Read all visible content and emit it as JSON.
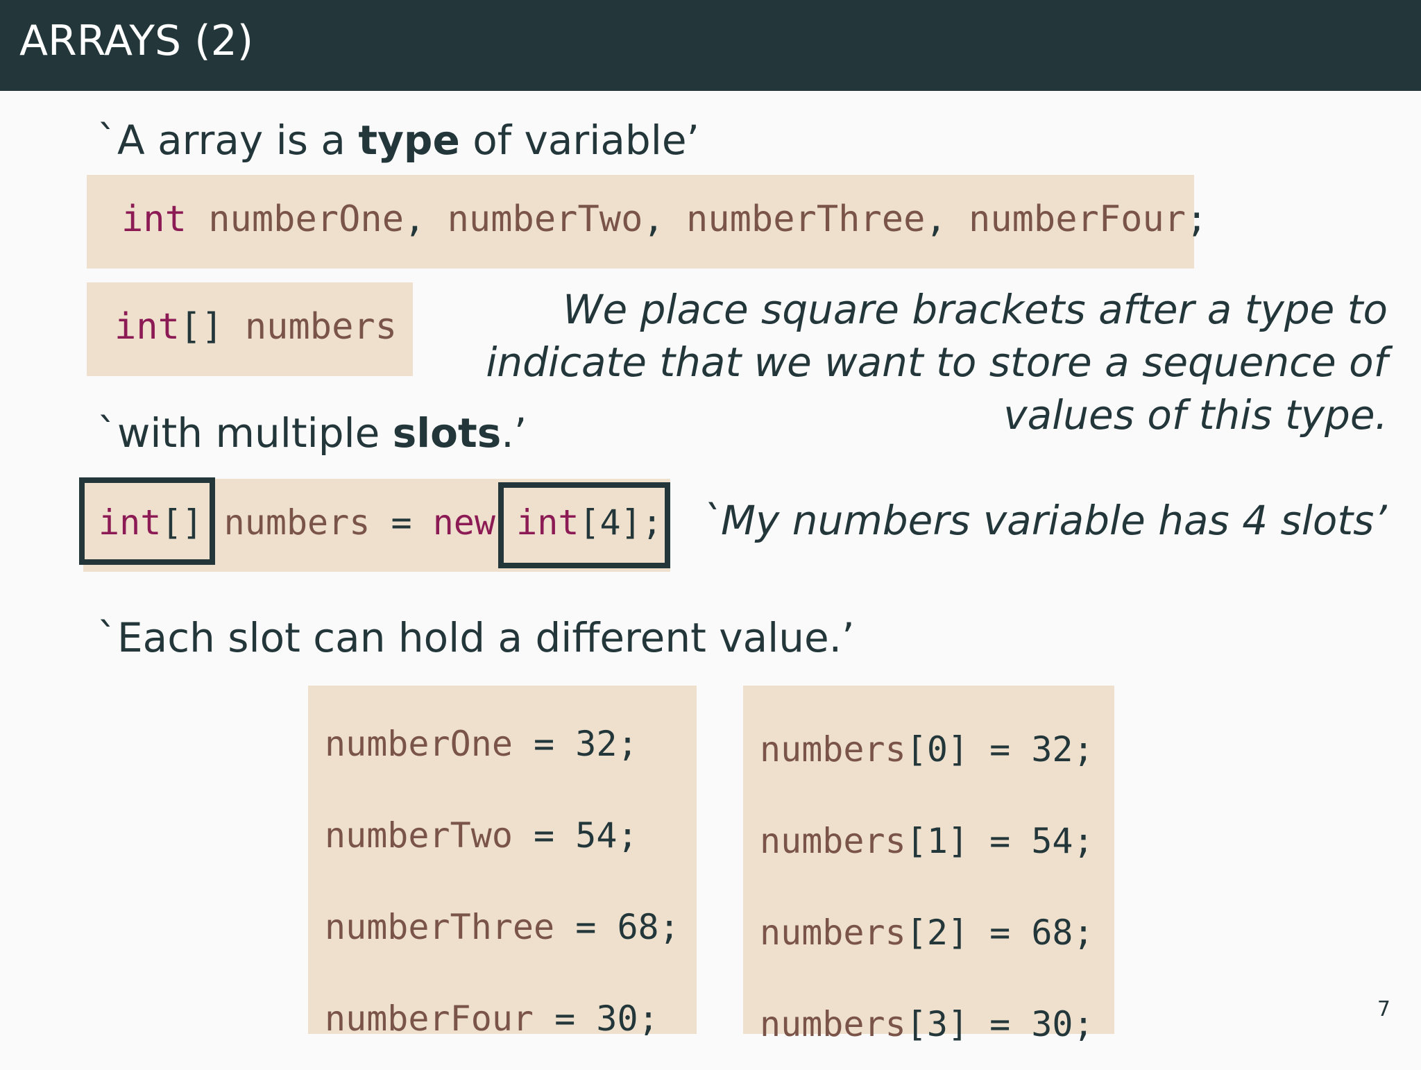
{
  "header": {
    "title": "ARRAYS (2)"
  },
  "quote1": {
    "pre": "`A array is a ",
    "bold": "type",
    "post": " of variable’"
  },
  "code1": {
    "kw": "int",
    "vars": [
      "numberOne",
      "numberTwo",
      "numberThree",
      "numberFour"
    ],
    "comma": ",",
    "semi": ";"
  },
  "code2": {
    "kw": "int",
    "brackets": "[]",
    "id": "numbers"
  },
  "note1": {
    "lines": [
      "We place square brackets after a type to",
      "indicate that we want to store a sequence of",
      "values of this type."
    ]
  },
  "quote2": {
    "pre": "`with multiple ",
    "bold": "slots",
    "post": ".’"
  },
  "code3": {
    "kw1": "int",
    "brackets": "[]",
    "id": "numbers",
    "eq": "=",
    "new": "new",
    "kw2": "int",
    "size": "[4];"
  },
  "note2": "`My numbers variable has 4 slots’",
  "quote3": "`Each slot can hold a different value.’",
  "left_block": [
    {
      "id": "numberOne",
      "rest": " = 32;"
    },
    {
      "id": "numberTwo",
      "rest": " = 54;"
    },
    {
      "id": "numberThree",
      "rest": " = 68;"
    },
    {
      "id": "numberFour",
      "rest": " = 30;"
    }
  ],
  "right_block": [
    {
      "id": "numbers",
      "rest": "[0] = 32;"
    },
    {
      "id": "numbers",
      "rest": "[1] = 54;"
    },
    {
      "id": "numbers",
      "rest": "[2] = 68;"
    },
    {
      "id": "numbers",
      "rest": "[3] = 30;"
    }
  ],
  "page_number": "7",
  "colors": {
    "header_bg": "#23373b",
    "code_bg": "#eee0cc",
    "keyword": "#8c1b55",
    "identifier": "#7a5448"
  }
}
